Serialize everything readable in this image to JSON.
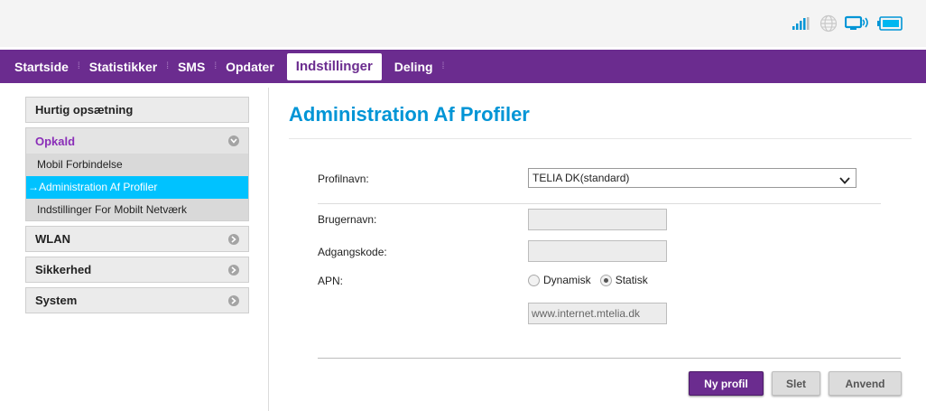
{
  "status_icons": [
    "signal-icon",
    "globe-icon",
    "monitor-wifi-icon",
    "battery-icon"
  ],
  "nav": {
    "items": [
      {
        "label": "Startside"
      },
      {
        "label": "Statistikker"
      },
      {
        "label": "SMS"
      },
      {
        "label": "Opdater"
      },
      {
        "label": "Indstillinger",
        "active": true
      },
      {
        "label": "Deling"
      }
    ]
  },
  "sidebar": {
    "quick_setup": "Hurtig opsætning",
    "call": {
      "label": "Opkald",
      "items": [
        "Mobil Forbindelse",
        "→Administration Af Profiler",
        "Indstillinger For Mobilt Netværk"
      ]
    },
    "wlan": "WLAN",
    "security": "Sikkerhed",
    "system": "System"
  },
  "main": {
    "title": "Administration Af Profiler",
    "profile_label": "Profilnavn:",
    "profile_value": "TELIA DK(standard)",
    "username_label": "Brugernavn:",
    "username_value": "",
    "password_label": "Adgangskode:",
    "password_value": "",
    "apn_label": "APN:",
    "apn_dynamic": "Dynamisk",
    "apn_static": "Statisk",
    "apn_value": "www.internet.mtelia.dk"
  },
  "buttons": {
    "new_profile": "Ny profil",
    "delete": "Slet",
    "apply": "Anvend"
  },
  "colors": {
    "nav_bg": "#6b2c8f",
    "title": "#0095d6",
    "active_item": "#00c2ff",
    "status_icon": "#0095d6"
  }
}
